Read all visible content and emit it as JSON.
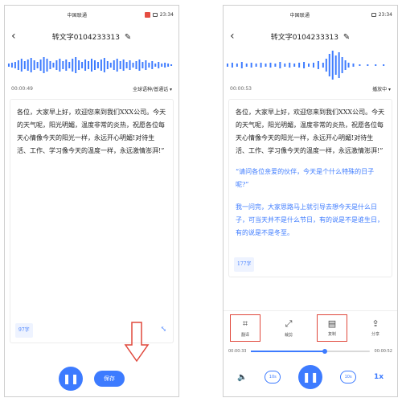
{
  "status": {
    "carrier": "中国联通",
    "time": "23:34"
  },
  "nav": {
    "back_glyph": "‹",
    "title": "转文字0104233313",
    "edit_glyph": "✎"
  },
  "left": {
    "time": "00:00:49",
    "lang_label": "全球语种/普通话 ▾",
    "paragraph": "各位，大家早上好，欢迎您来到我们XXX公司。今天的天气呢，阳光明媚，温度非常的炎热，祝愿各位每天心情像今天的阳光一样，永远开心明媚!对待生活、工作、学习像今天的温度一样，永远激情澎湃!”",
    "word_count": "97字",
    "expand_glyph": "⤡",
    "play_glyph": "❚❚",
    "save_label": "保存",
    "arrow_color": "#e0483c"
  },
  "right": {
    "time": "00:00:53",
    "speaker_label": "播放中 ▾",
    "paragraph1": "各位，大家早上好，欢迎您来到我们XXX公司。今天的天气呢，阳光明媚，温度非常的炎热，祝愿各位每天心情像今天的阳光一样，永远开心明媚!对待生活、工作、学习像今天的温度一样，永远激情澎湃!”",
    "quote": "“请问各位亲爱的伙伴，今天是个什么特殊的日子呢?”",
    "answer": "我一问完，大家思路马上就引导去想今天是什么日子，可当天并不是什么节日，有的说是不是谁生日，有的说是不是冬至。",
    "word_count": "177字",
    "tools": [
      {
        "icon": "⌗",
        "label": "翻译"
      },
      {
        "icon": "⤢",
        "label": "裁剪"
      },
      {
        "icon": "▤",
        "label": "复制"
      },
      {
        "icon": "⇪",
        "label": "分享"
      }
    ],
    "progress": {
      "start": "00:00:33",
      "end": "00:00:52",
      "fraction": 0.62
    },
    "controls": {
      "volume_glyph": "🔈",
      "back10": "10s",
      "play_glyph": "❚❚",
      "fwd10": "10s",
      "speed": "1x"
    },
    "accent": "#3d7bff",
    "highlight": "#e0483c"
  }
}
